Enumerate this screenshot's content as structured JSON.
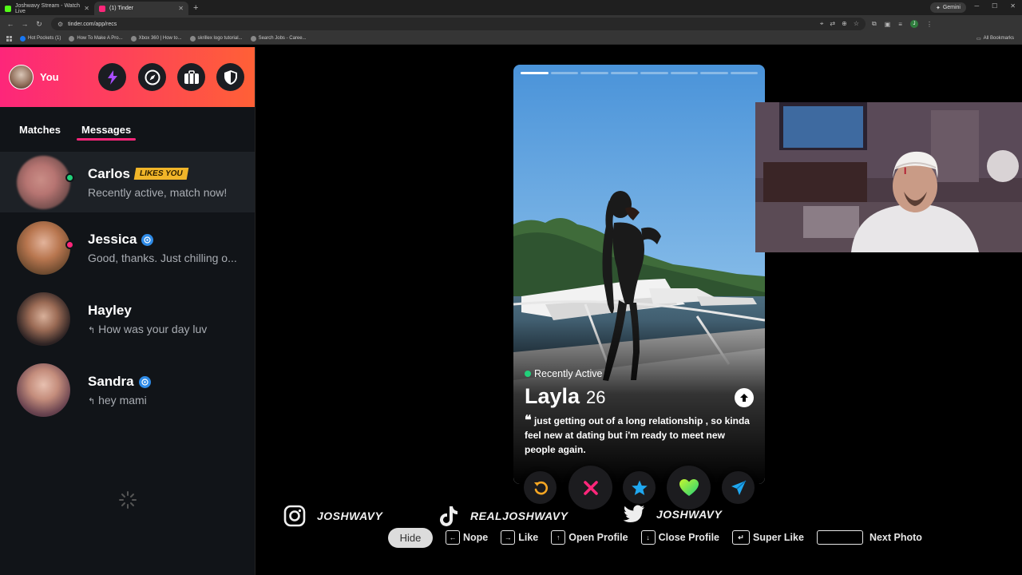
{
  "browser": {
    "tabs": [
      {
        "title": "Joshwavy Stream - Watch Live",
        "favicon_color": "#53fc18"
      },
      {
        "title": "(1) Tinder",
        "favicon_color": "#fd267a"
      }
    ],
    "new_tab": "+",
    "gemini_label": "Gemini",
    "url": "tinder.com/app/recs",
    "profile_initial": "J",
    "bookmarks": [
      "Hot Pockets (1)",
      "How To Make A Pro...",
      "Xbox 360 | How to...",
      "skrillex logo tutorial...",
      "Search Jobs - Caree..."
    ],
    "all_bookmarks": "All Bookmarks"
  },
  "sidebar": {
    "you_label": "You",
    "header_buttons": [
      "boost-icon",
      "explore-icon",
      "briefcase-icon",
      "shield-icon"
    ],
    "tabs": [
      {
        "label": "Matches",
        "active": false
      },
      {
        "label": "Messages",
        "active": true
      }
    ],
    "messages": [
      {
        "name": "Carlos",
        "badge": "LIKES YOU",
        "text": "Recently active, match now!",
        "verified": false,
        "status": "online"
      },
      {
        "name": "Jessica",
        "badge": "",
        "text": "Good, thanks. Just chilling o...",
        "verified": true,
        "status": "unread"
      },
      {
        "name": "Hayley",
        "badge": "",
        "text": "How was your day luv",
        "verified": false,
        "status": "none"
      },
      {
        "name": "Sandra",
        "badge": "",
        "text": "hey mami",
        "verified": true,
        "status": "none"
      }
    ]
  },
  "card": {
    "photo_count": 8,
    "current_photo": 1,
    "active_status": "Recently Active",
    "name": "Layla",
    "age": "26",
    "bio": "just getting out of a long relationship , so kinda feel new at dating but i'm ready to meet new people again."
  },
  "actions": [
    "rewind-icon",
    "nope-icon",
    "super-like-icon",
    "like-icon",
    "boost-send-icon"
  ],
  "colors": {
    "brand_pink": "#fd267a",
    "brand_orange": "#ff6036",
    "likes_badge": "#f0b529",
    "online": "#21d07a"
  },
  "socials": [
    {
      "platform": "instagram",
      "handle": "JOSHWAVY"
    },
    {
      "platform": "tiktok",
      "handle": "REALJOSHWAVY"
    },
    {
      "platform": "twitter",
      "handle": "JOSHWAVY"
    }
  ],
  "shortcuts": {
    "hide": "Hide",
    "nope": "Nope",
    "like": "Like",
    "open_profile": "Open Profile",
    "close_profile": "Close Profile",
    "super_like": "Super Like",
    "next_photo": "Next Photo"
  }
}
